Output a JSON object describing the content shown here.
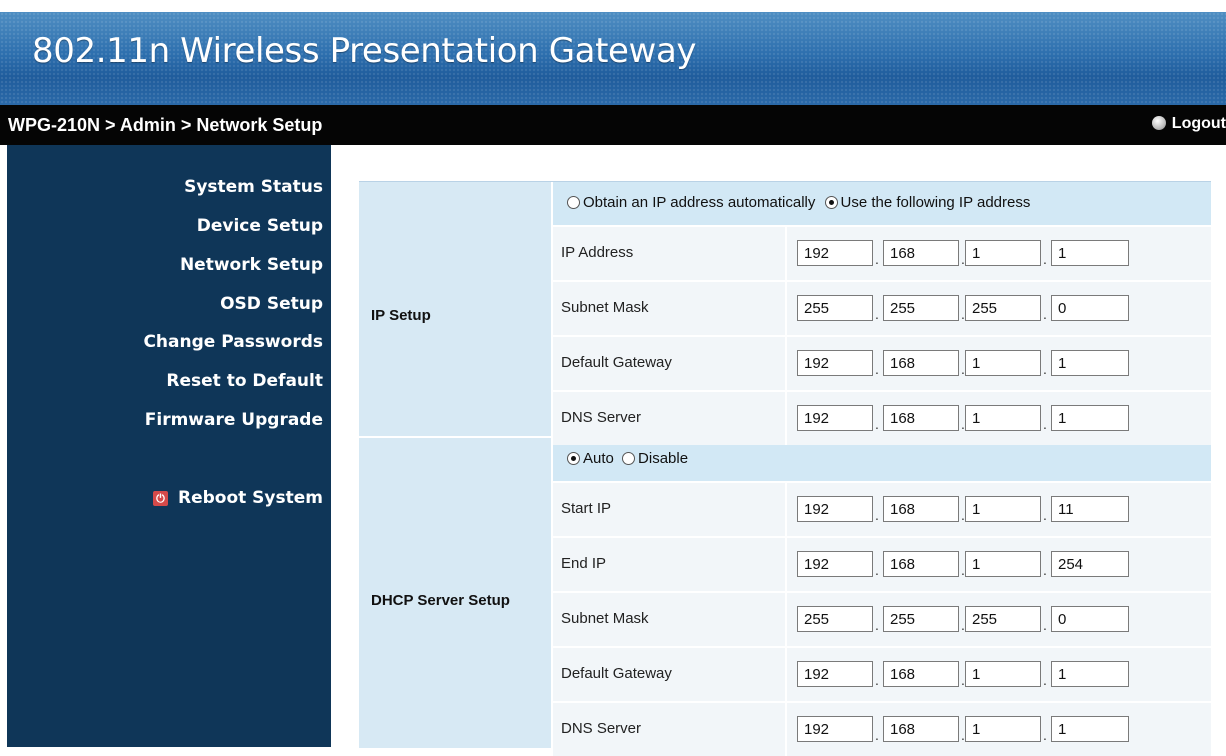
{
  "header": {
    "title": "802.11n Wireless Presentation Gateway"
  },
  "breadcrumb": "WPG-210N > Admin > Network Setup",
  "logout_label": "Logout",
  "sidebar": {
    "items": [
      {
        "label": "System Status"
      },
      {
        "label": "Device Setup"
      },
      {
        "label": "Network Setup"
      },
      {
        "label": "OSD Setup"
      },
      {
        "label": "Change Passwords"
      },
      {
        "label": "Reset to Default"
      },
      {
        "label": "Firmware Upgrade"
      }
    ],
    "reboot_label": "Reboot System",
    "reboot_icon": "power-icon"
  },
  "ip_setup": {
    "section_label": "IP Setup",
    "mode_auto_label": "Obtain an IP address automatically",
    "mode_manual_label": "Use the following IP address",
    "selected_mode": "manual",
    "rows": [
      {
        "label": "IP Address",
        "octets": [
          "192",
          "168",
          "1",
          "1"
        ]
      },
      {
        "label": "Subnet Mask",
        "octets": [
          "255",
          "255",
          "255",
          "0"
        ]
      },
      {
        "label": "Default Gateway",
        "octets": [
          "192",
          "168",
          "1",
          "1"
        ]
      },
      {
        "label": "DNS Server",
        "octets": [
          "192",
          "168",
          "1",
          "1"
        ]
      }
    ]
  },
  "dhcp": {
    "section_label": "DHCP Server Setup",
    "auto_label": "Auto",
    "disable_label": "Disable",
    "selected": "auto",
    "rows": [
      {
        "label": "Start IP",
        "octets": [
          "192",
          "168",
          "1",
          "11"
        ]
      },
      {
        "label": "End IP",
        "octets": [
          "192",
          "168",
          "1",
          "254"
        ]
      },
      {
        "label": "Subnet Mask",
        "octets": [
          "255",
          "255",
          "255",
          "0"
        ]
      },
      {
        "label": "Default Gateway",
        "octets": [
          "192",
          "168",
          "1",
          "1"
        ]
      },
      {
        "label": "DNS Server",
        "octets": [
          "192",
          "168",
          "1",
          "1"
        ]
      }
    ]
  },
  "colors": {
    "banner": "#2d6fae",
    "sidebar": "#0f3658",
    "panel": "#d7e9f4",
    "row": "#f2f6f9"
  }
}
